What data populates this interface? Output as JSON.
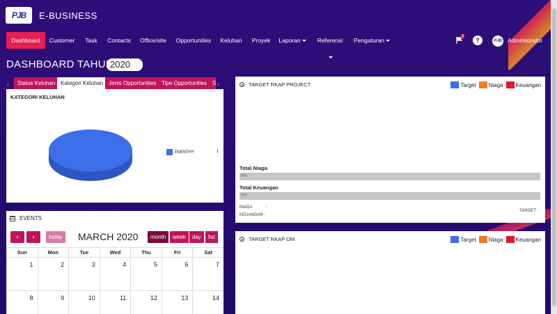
{
  "header": {
    "logo_text": "PJB",
    "app_title": "E-BUSINESS"
  },
  "nav": {
    "items": [
      {
        "label": "Dashboard"
      },
      {
        "label": "Customer"
      },
      {
        "label": "Task"
      },
      {
        "label": "Contacts"
      },
      {
        "label": "Office/site"
      },
      {
        "label": "Opportunities"
      },
      {
        "label": "Keluhan"
      },
      {
        "label": "Proyek"
      },
      {
        "label": "Laporan"
      },
      {
        "label": "Referensi"
      },
      {
        "label": "Pengaturan"
      }
    ],
    "flag_badge": "3",
    "help_glyph": "?",
    "user_name": "Administrator",
    "avatar_text": "PJB"
  },
  "dashboard": {
    "title": "DASHBOARD TAHUN",
    "year": "2020"
  },
  "tabs": {
    "prev": "‹",
    "next": "›",
    "items": [
      {
        "label": "Status Keluhan"
      },
      {
        "label": "Kategori Keluhan"
      },
      {
        "label": "Jenis Opportunities"
      },
      {
        "label": "Tipe Opportunities"
      },
      {
        "label": "S"
      }
    ]
  },
  "kategori": {
    "title": "KATEGORI KELUHAN",
    "legend_label": "EMPATHY",
    "legend_value": "1",
    "slice_color": "#3b6ee8"
  },
  "chart_data": {
    "type": "pie",
    "title": "KATEGORI KELUHAN",
    "categories": [
      "EMPATHY"
    ],
    "values": [
      1
    ]
  },
  "events": {
    "title": "EVENTS",
    "prev": "‹",
    "next": "›",
    "today": "today",
    "month_title": "MARCH 2020",
    "views": [
      {
        "label": "month"
      },
      {
        "label": "week"
      },
      {
        "label": "day"
      },
      {
        "label": "list"
      }
    ],
    "weekdays": [
      "Sun",
      "Mon",
      "Tue",
      "Wed",
      "Thu",
      "Fri",
      "Sat"
    ],
    "weeks": [
      [
        "1",
        "2",
        "3",
        "4",
        "5",
        "6",
        "7"
      ],
      [
        "8",
        "9",
        "10",
        "11",
        "12",
        "13",
        "14"
      ]
    ]
  },
  "rkap_project": {
    "title": "TARGET RKAP PROJECT",
    "legend": [
      {
        "label": "Target",
        "color": "#3b6ee8"
      },
      {
        "label": "Niaga",
        "color": "#f07b1d"
      },
      {
        "label": "Keuangan",
        "color": "#e3162c"
      }
    ],
    "total_niaga_label": "Total Niaga",
    "total_niaga_value": "0%",
    "total_niaga_progress": 0,
    "total_keuangan_label": "Total Keuangan",
    "total_keuangan_value": "0%",
    "total_keuangan_progress": 0,
    "niaga_label": "NIAGA",
    "niaga_sep": ":",
    "keuangan_label": "KEUANGAN :",
    "target_label": "TARGET :"
  },
  "rkap_om": {
    "title": "TARGET RKAP OM",
    "legend": [
      {
        "label": "Target",
        "color": "#3b6ee8"
      },
      {
        "label": "Niaga",
        "color": "#f07b1d"
      },
      {
        "label": "Keuangan",
        "color": "#e3162c"
      }
    ]
  }
}
